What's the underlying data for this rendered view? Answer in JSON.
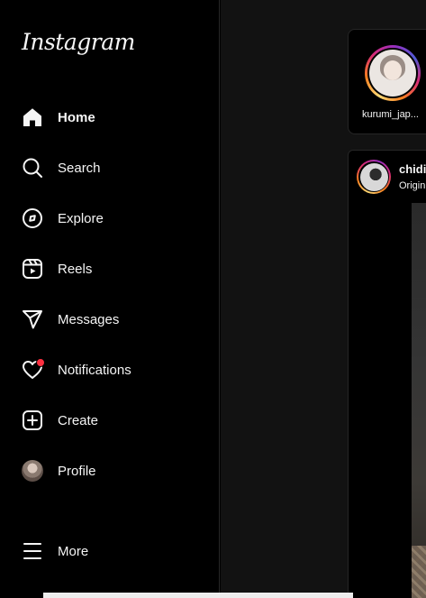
{
  "app": {
    "brand": "Instagram"
  },
  "sidebar": {
    "items": [
      {
        "label": "Home",
        "icon": "home-icon",
        "active": true
      },
      {
        "label": "Search",
        "icon": "search-icon"
      },
      {
        "label": "Explore",
        "icon": "compass-icon"
      },
      {
        "label": "Reels",
        "icon": "reels-icon"
      },
      {
        "label": "Messages",
        "icon": "paper-plane-icon"
      },
      {
        "label": "Notifications",
        "icon": "heart-icon",
        "badge_color": "#ff3040"
      },
      {
        "label": "Create",
        "icon": "plus-square-icon"
      },
      {
        "label": "Profile",
        "icon": "avatar"
      }
    ],
    "more": {
      "label": "More",
      "icon": "hamburger-menu-icon"
    }
  },
  "stories": {
    "items": [
      {
        "username": "kurumi_jap..."
      }
    ]
  },
  "feed": {
    "post": {
      "username": "chidi",
      "subtitle": "Origin"
    }
  },
  "colors": {
    "background": "#000000",
    "main_background": "#121212",
    "border": "#262626",
    "text": "#f5f5f5",
    "notification_dot": "#ff3040"
  }
}
